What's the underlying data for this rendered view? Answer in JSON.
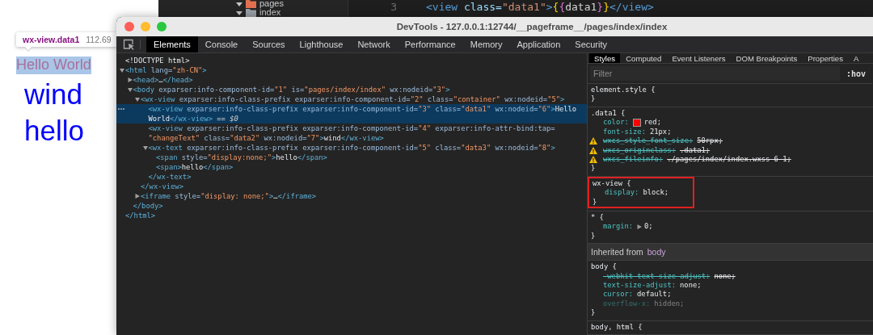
{
  "simulator": {
    "tooltip": {
      "selector": "wx-view.data1",
      "size": "112.69"
    },
    "texts": [
      {
        "text": "Hello World",
        "kind": "small",
        "highlighted": true
      },
      {
        "text": "wind",
        "kind": "large",
        "highlighted": false
      },
      {
        "text": "hello",
        "kind": "large",
        "highlighted": false
      }
    ]
  },
  "editor": {
    "file_tree": [
      {
        "label": "pages",
        "expanded": true,
        "color": "#e2704f"
      },
      {
        "label": "index",
        "expanded": true,
        "color": "#9aa0a6"
      }
    ],
    "line_number": "3",
    "code": [
      {
        "kind": "tag",
        "text": "<view"
      },
      {
        "kind": "attr",
        "text": " class="
      },
      {
        "kind": "str",
        "text": "\"data1\""
      },
      {
        "kind": "tag",
        "text": ">"
      },
      {
        "kind": "brace1",
        "text": "{"
      },
      {
        "kind": "brace2",
        "text": "{"
      },
      {
        "kind": "var",
        "text": "data1"
      },
      {
        "kind": "brace2",
        "text": "}"
      },
      {
        "kind": "brace1",
        "text": "}"
      },
      {
        "kind": "tag",
        "text": "</view>"
      }
    ]
  },
  "devtools": {
    "title": "DevTools - 127.0.0.1:12744/__pageframe__/pages/index/index",
    "tabs": [
      {
        "label": "Elements",
        "selected": true
      },
      {
        "label": "Console",
        "selected": false
      },
      {
        "label": "Sources",
        "selected": false
      },
      {
        "label": "Lighthouse",
        "selected": false
      },
      {
        "label": "Network",
        "selected": false
      },
      {
        "label": "Performance",
        "selected": false
      },
      {
        "label": "Memory",
        "selected": false
      },
      {
        "label": "Application",
        "selected": false
      },
      {
        "label": "Security",
        "selected": false
      }
    ],
    "dom_tree": [
      {
        "lines": [
          [
            {
              "kind": "x",
              "text": "<!DOCTYPE html>"
            }
          ]
        ],
        "selected": false
      },
      {
        "lines": [
          [
            {
              "kind": "t",
              "text": "<html"
            },
            {
              "kind": "a",
              "text": " lang="
            },
            {
              "kind": "v",
              "text": "\"zh-CN\""
            },
            {
              "kind": "t",
              "text": ">"
            }
          ]
        ],
        "selected": false,
        "expanded": true,
        "close": [
          {
            "kind": "t",
            "text": "</html>"
          }
        ],
        "children": [
          {
            "lines": [
              [
                {
                  "kind": "t",
                  "text": "<head>"
                },
                {
                  "kind": "x",
                  "text": "…"
                },
                {
                  "kind": "t",
                  "text": "</head>"
                }
              ]
            ],
            "selected": false,
            "expanded": false
          },
          {
            "lines": [
              [
                {
                  "kind": "t",
                  "text": "<body"
                },
                {
                  "kind": "a",
                  "text": " exparser:info-component-id="
                },
                {
                  "kind": "v",
                  "text": "\"1\""
                },
                {
                  "kind": "a",
                  "text": " is="
                },
                {
                  "kind": "v",
                  "text": "\"pages/index/index\""
                },
                {
                  "kind": "a",
                  "text": " wx:nodeid="
                },
                {
                  "kind": "v",
                  "text": "\"3\""
                },
                {
                  "kind": "t",
                  "text": ">"
                }
              ]
            ],
            "selected": false,
            "expanded": true,
            "close": [
              {
                "kind": "t",
                "text": "</body>"
              }
            ],
            "children": [
              {
                "lines": [
                  [
                    {
                      "kind": "t",
                      "text": "<wx-view"
                    },
                    {
                      "kind": "a",
                      "text": " exparser:info-class-prefix exparser:info-component-id="
                    },
                    {
                      "kind": "v",
                      "text": "\"2\""
                    },
                    {
                      "kind": "a",
                      "text": " class="
                    },
                    {
                      "kind": "v",
                      "text": "\"container\""
                    },
                    {
                      "kind": "a",
                      "text": " wx:nodeid="
                    },
                    {
                      "kind": "v",
                      "text": "\"5\""
                    },
                    {
                      "kind": "t",
                      "text": ">"
                    }
                  ]
                ],
                "selected": false,
                "expanded": true,
                "close": [
                  {
                    "kind": "t",
                    "text": "</wx-view>"
                  }
                ],
                "children": [
                  {
                    "lines": [
                      [
                        {
                          "kind": "t",
                          "text": "<wx-view"
                        },
                        {
                          "kind": "a",
                          "text": " exparser:info-class-prefix exparser:info-component-id="
                        },
                        {
                          "kind": "v",
                          "text": "\"3\""
                        },
                        {
                          "kind": "a",
                          "text": " class="
                        },
                        {
                          "kind": "v",
                          "text": "\"data1\""
                        },
                        {
                          "kind": "a",
                          "text": " wx:nodeid="
                        },
                        {
                          "kind": "v",
                          "text": "\"6\""
                        },
                        {
                          "kind": "t",
                          "text": ">"
                        },
                        {
                          "kind": "x",
                          "text": "Hello"
                        }
                      ],
                      [
                        {
                          "kind": "x",
                          "text": "World"
                        },
                        {
                          "kind": "t",
                          "text": "</wx-view>"
                        },
                        {
                          "kind": "s",
                          "text": " == $0"
                        }
                      ]
                    ],
                    "selected": true
                  },
                  {
                    "lines": [
                      [
                        {
                          "kind": "t",
                          "text": "<wx-view"
                        },
                        {
                          "kind": "a",
                          "text": " exparser:info-class-prefix exparser:info-component-id="
                        },
                        {
                          "kind": "v",
                          "text": "\"4\""
                        },
                        {
                          "kind": "a",
                          "text": " exparser:info-attr-bind:tap="
                        }
                      ],
                      [
                        {
                          "kind": "v",
                          "text": "\"changeText\""
                        },
                        {
                          "kind": "a",
                          "text": " class="
                        },
                        {
                          "kind": "v",
                          "text": "\"data2\""
                        },
                        {
                          "kind": "a",
                          "text": " wx:nodeid="
                        },
                        {
                          "kind": "v",
                          "text": "\"7\""
                        },
                        {
                          "kind": "t",
                          "text": ">"
                        },
                        {
                          "kind": "x",
                          "text": "wind"
                        },
                        {
                          "kind": "t",
                          "text": "</wx-view>"
                        }
                      ]
                    ],
                    "selected": false
                  },
                  {
                    "lines": [
                      [
                        {
                          "kind": "t",
                          "text": "<wx-text"
                        },
                        {
                          "kind": "a",
                          "text": " exparser:info-class-prefix exparser:info-component-id="
                        },
                        {
                          "kind": "v",
                          "text": "\"5\""
                        },
                        {
                          "kind": "a",
                          "text": " class="
                        },
                        {
                          "kind": "v",
                          "text": "\"data3\""
                        },
                        {
                          "kind": "a",
                          "text": " wx:nodeid="
                        },
                        {
                          "kind": "v",
                          "text": "\"8\""
                        },
                        {
                          "kind": "t",
                          "text": ">"
                        }
                      ]
                    ],
                    "selected": false,
                    "expanded": true,
                    "close": [
                      {
                        "kind": "t",
                        "text": "</wx-text>"
                      }
                    ],
                    "children": [
                      {
                        "lines": [
                          [
                            {
                              "kind": "t",
                              "text": "<span"
                            },
                            {
                              "kind": "a",
                              "text": " style="
                            },
                            {
                              "kind": "v",
                              "text": "\"display:none;\""
                            },
                            {
                              "kind": "t",
                              "text": ">"
                            },
                            {
                              "kind": "x",
                              "text": "hello"
                            },
                            {
                              "kind": "t",
                              "text": "</span>"
                            }
                          ]
                        ],
                        "selected": false
                      },
                      {
                        "lines": [
                          [
                            {
                              "kind": "t",
                              "text": "<span>"
                            },
                            {
                              "kind": "x",
                              "text": "hello"
                            },
                            {
                              "kind": "t",
                              "text": "</span>"
                            }
                          ]
                        ],
                        "selected": false
                      }
                    ]
                  }
                ]
              },
              {
                "lines": [
                  [
                    {
                      "kind": "t",
                      "text": "<iframe"
                    },
                    {
                      "kind": "a",
                      "text": " style="
                    },
                    {
                      "kind": "v",
                      "text": "\"display: none;\""
                    },
                    {
                      "kind": "t",
                      "text": ">"
                    },
                    {
                      "kind": "x",
                      "text": "…"
                    },
                    {
                      "kind": "t",
                      "text": "</iframe>"
                    }
                  ]
                ],
                "selected": false,
                "expanded": false
              }
            ]
          }
        ]
      }
    ],
    "styles": {
      "tabs": [
        {
          "label": "Styles",
          "selected": true
        },
        {
          "label": "Computed",
          "selected": false
        },
        {
          "label": "Event Listeners",
          "selected": false
        },
        {
          "label": "DOM Breakpoints",
          "selected": false
        },
        {
          "label": "Properties",
          "selected": false
        },
        {
          "label": "A",
          "selected": false
        }
      ],
      "filter": {
        "placeholder": "Filter"
      },
      "hov": ":hov",
      "rules": [
        {
          "kind": "rule",
          "selector": "element.style {",
          "close": "}",
          "highlighted": false
        },
        {
          "kind": "rule",
          "selector": ".data1 {",
          "close": "}",
          "highlighted": false,
          "declarations": [
            {
              "name": "color:",
              "value": "red;",
              "color": "#ff0000",
              "struck": false,
              "warning": false,
              "inactive": false
            },
            {
              "name": "font-size:",
              "value": "21px;",
              "struck": false,
              "warning": false,
              "inactive": false
            },
            {
              "name": "wxcs_style_font_size:",
              "value": "50rpx;",
              "struck": true,
              "warning": true,
              "inactive": false
            },
            {
              "name": "wxcs_originclass:",
              "value": ".data1;",
              "struck": true,
              "warning": true,
              "inactive": false
            },
            {
              "name": "wxcs_fileinfo:",
              "value": "./pages/index/index.wxss 6 1;",
              "struck": true,
              "warning": true,
              "inactive": false
            }
          ]
        },
        {
          "kind": "rule",
          "selector": "wx-view {",
          "close": "}",
          "highlighted": true,
          "declarations": [
            {
              "name": "display:",
              "value": "block;",
              "struck": false,
              "warning": false,
              "inactive": false
            }
          ]
        },
        {
          "kind": "rule",
          "selector": "* {",
          "close": "}",
          "highlighted": false,
          "declarations": [
            {
              "name": "margin:",
              "value": "0;",
              "expandable": true,
              "struck": false,
              "warning": false,
              "inactive": false
            }
          ]
        },
        {
          "kind": "inherited",
          "label": "Inherited from",
          "target": "body"
        },
        {
          "kind": "rule",
          "selector": "body {",
          "close": "}",
          "highlighted": false,
          "declarations": [
            {
              "name": "-webkit-text-size-adjust:",
              "value": "none;",
              "struck": true,
              "warning": false,
              "inactive": false
            },
            {
              "name": "text-size-adjust:",
              "value": "none;",
              "struck": false,
              "warning": false,
              "inactive": false
            },
            {
              "name": "cursor:",
              "value": "default;",
              "struck": false,
              "warning": false,
              "inactive": false
            },
            {
              "name": "overflow-x:",
              "value": "hidden;",
              "struck": false,
              "warning": false,
              "inactive": true
            }
          ]
        },
        {
          "kind": "rule",
          "selector": "body, html {",
          "highlighted": false
        }
      ]
    }
  }
}
